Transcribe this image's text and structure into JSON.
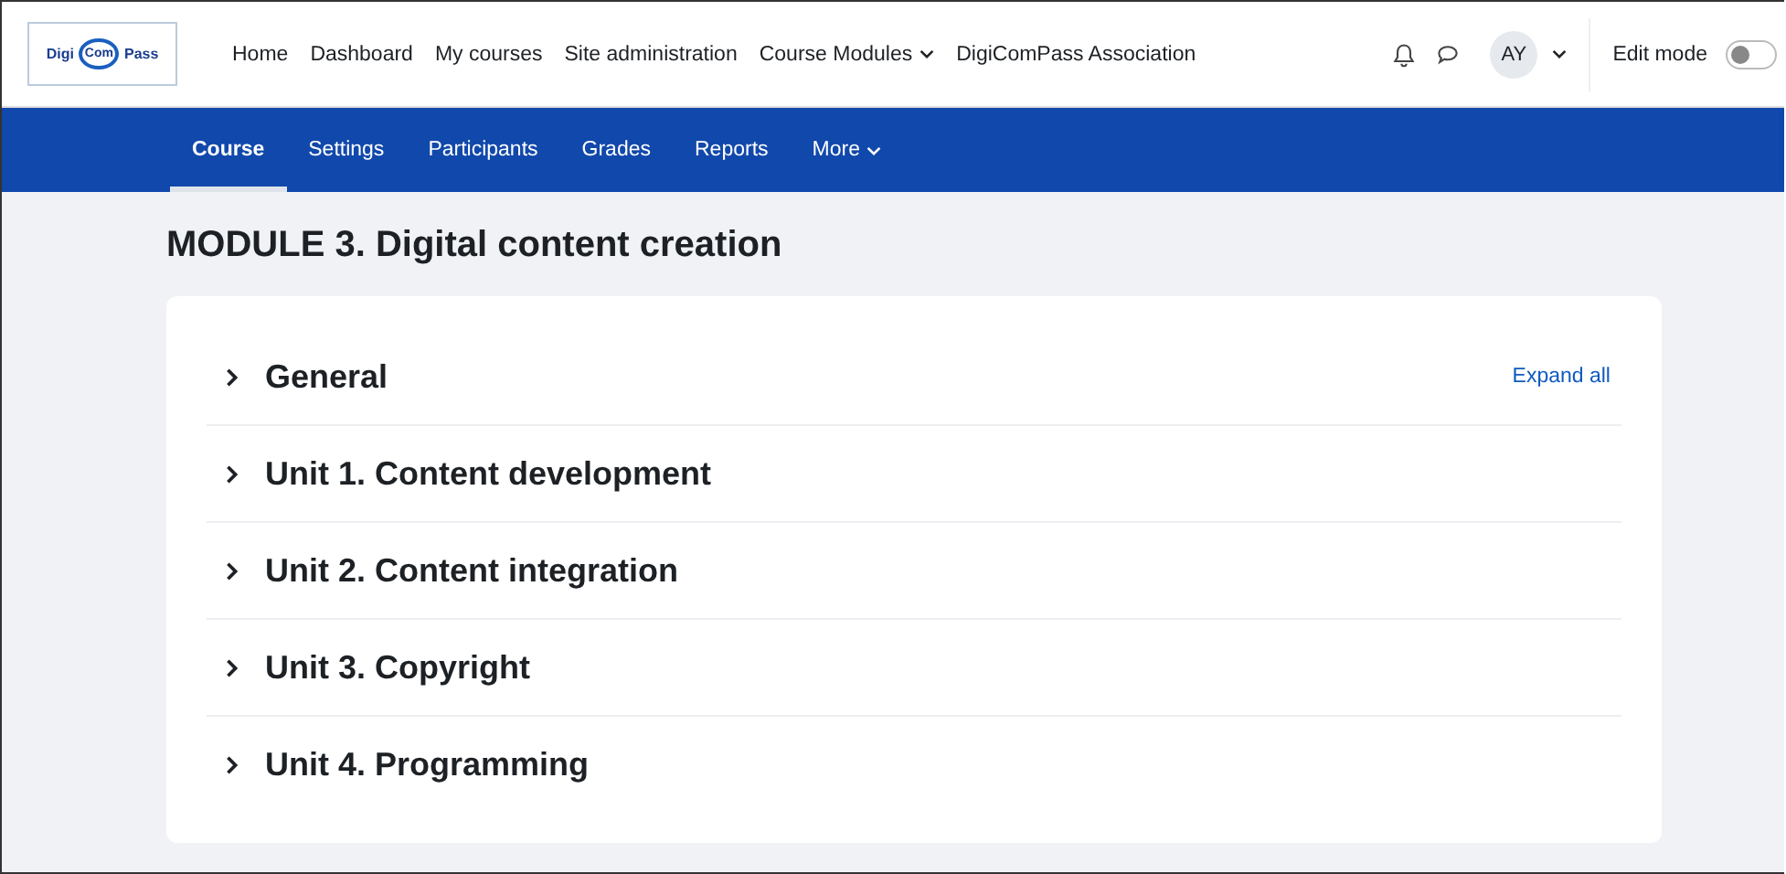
{
  "logo": {
    "parts": [
      "Digi",
      "Com",
      "Pass"
    ]
  },
  "primary_nav": [
    {
      "label": "Home",
      "has_menu": false
    },
    {
      "label": "Dashboard",
      "has_menu": false
    },
    {
      "label": "My courses",
      "has_menu": false
    },
    {
      "label": "Site administration",
      "has_menu": false
    },
    {
      "label": "Course Modules",
      "has_menu": true
    },
    {
      "label": "DigiComPass Association",
      "has_menu": false
    }
  ],
  "user": {
    "initials": "AY"
  },
  "edit_mode": {
    "label": "Edit mode",
    "on": false
  },
  "secondary_nav": [
    {
      "label": "Course",
      "selected": true,
      "has_menu": false
    },
    {
      "label": "Settings",
      "selected": false,
      "has_menu": false
    },
    {
      "label": "Participants",
      "selected": false,
      "has_menu": false
    },
    {
      "label": "Grades",
      "selected": false,
      "has_menu": false
    },
    {
      "label": "Reports",
      "selected": false,
      "has_menu": false
    },
    {
      "label": "More",
      "selected": false,
      "has_menu": true
    }
  ],
  "page_title": "MODULE 3. Digital content creation",
  "expand_all": "Expand all",
  "sections": [
    {
      "title": "General",
      "expanded": false
    },
    {
      "title": "Unit 1. Content development",
      "expanded": false
    },
    {
      "title": "Unit 2. Content integration",
      "expanded": false
    },
    {
      "title": "Unit 3. Copyright",
      "expanded": false
    },
    {
      "title": "Unit 4. Programming",
      "expanded": false
    }
  ]
}
